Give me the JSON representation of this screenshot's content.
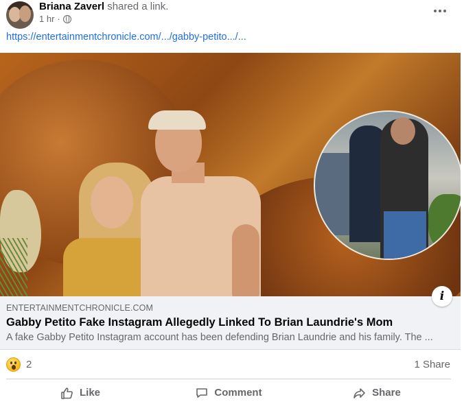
{
  "post": {
    "author": "Briana Zaverl",
    "action_text": "shared a link.",
    "time": "1 hr",
    "privacy_icon": "globe-icon",
    "link_url": "https://entertainmentchronicle.com/.../gabby-petito.../..."
  },
  "preview": {
    "domain": "ENTERTAINMENTCHRONICLE.COM",
    "title": "Gabby Petito Fake Instagram Allegedly Linked To Brian Laundrie's Mom",
    "description": "A fake Gabby Petito Instagram account has been defending Brian Laundrie and his family. The ...",
    "info_label": "i"
  },
  "engagement": {
    "reaction_icon": "wow-reaction-icon",
    "reaction_count": "2",
    "shares": "1 Share"
  },
  "actions": {
    "like": "Like",
    "comment": "Comment",
    "share": "Share"
  },
  "colors": {
    "link": "#216fdb",
    "muted": "#65676b",
    "preview_bg": "#f0f2f5"
  }
}
